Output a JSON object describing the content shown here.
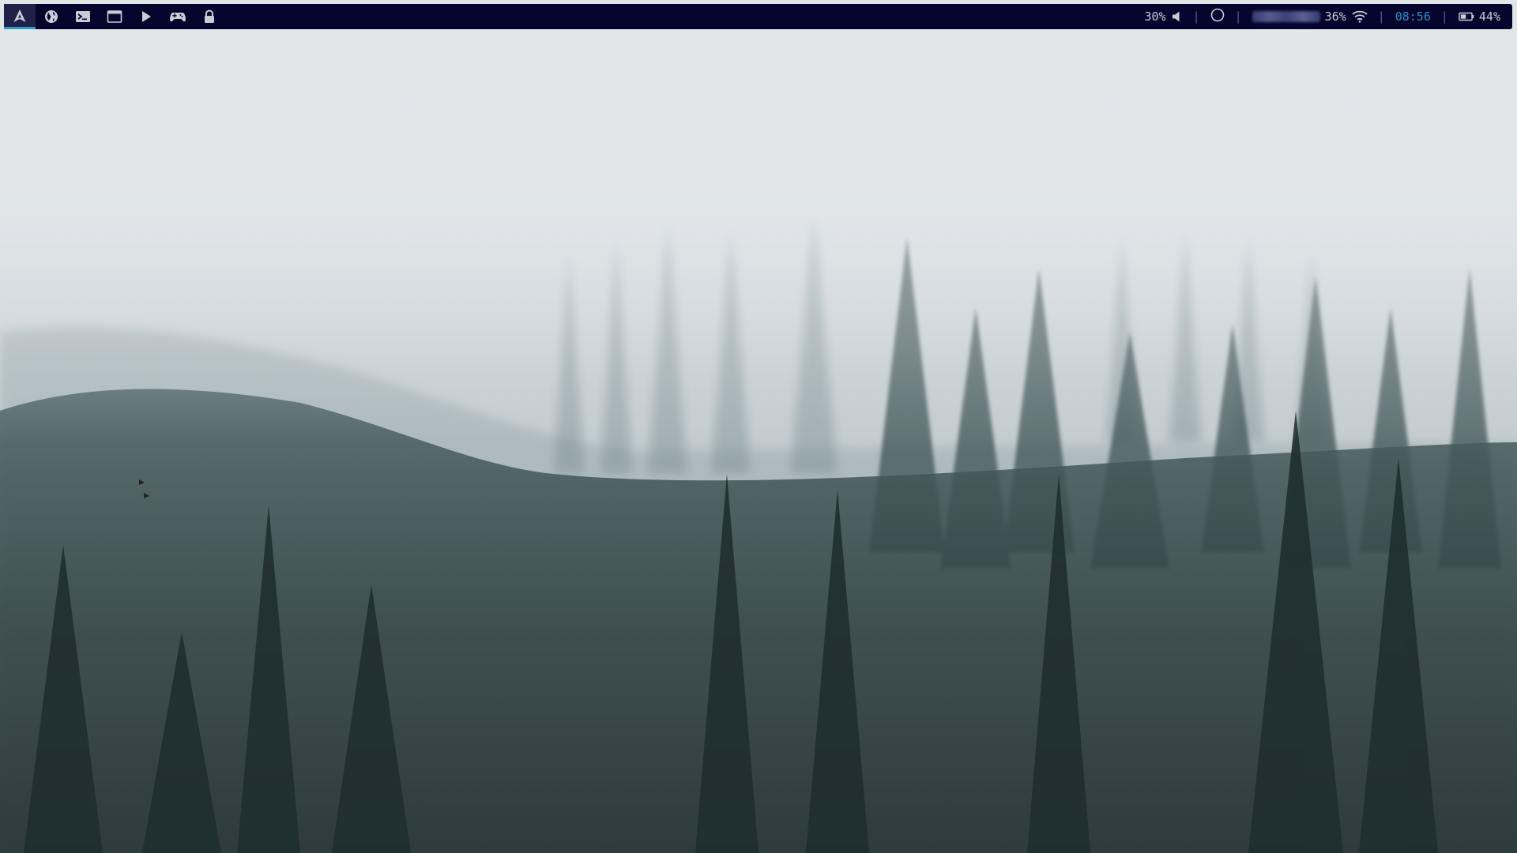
{
  "wallpaper": {
    "subject": "foggy-pine-forest"
  },
  "topbar": {
    "workspaces": [
      {
        "icon": "arch-logo-icon",
        "active": true
      },
      {
        "icon": "globe-icon",
        "active": false
      },
      {
        "icon": "terminal-icon",
        "active": false
      },
      {
        "icon": "window-icon",
        "active": false
      },
      {
        "icon": "play-icon",
        "active": false
      },
      {
        "icon": "gamepad-icon",
        "active": false
      },
      {
        "icon": "lock-icon",
        "active": false
      }
    ],
    "volume": {
      "value": "30%",
      "icon": "speaker-icon"
    },
    "sep1": "|",
    "status": {
      "icon": "circle-icon"
    },
    "sep2": "|",
    "network": {
      "ssid_hidden": true,
      "strength": "36%",
      "icon": "wifi-icon"
    },
    "sep3": "|",
    "clock": "08:56",
    "sep4": "|",
    "battery": {
      "value": "44%",
      "icon": "battery-icon"
    },
    "colors": {
      "bar_bg": "#06052e",
      "accent": "#2f9ac8",
      "text": "#c9cbd6",
      "separator": "#4b5a9a"
    }
  }
}
